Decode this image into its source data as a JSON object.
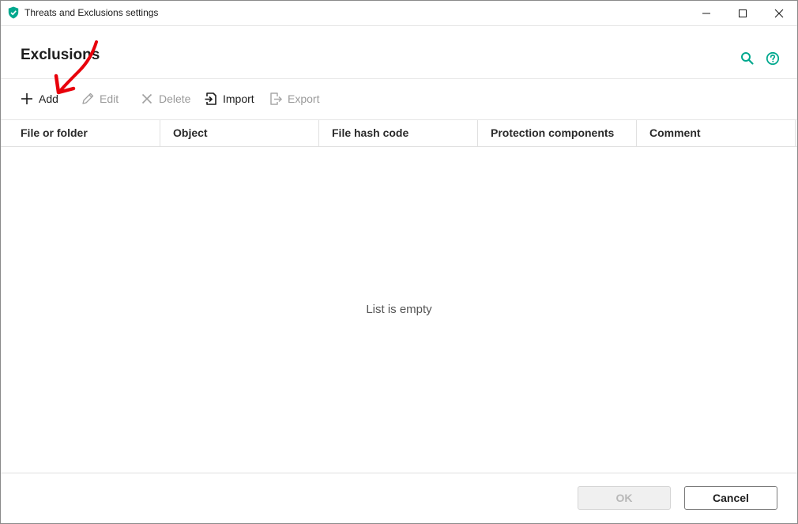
{
  "window": {
    "title": "Threats and Exclusions settings",
    "controls": {
      "minimize": "minimize",
      "maximize": "maximize",
      "close": "close"
    }
  },
  "header": {
    "title": "Exclusions",
    "icons": [
      "search-icon",
      "help-icon"
    ]
  },
  "toolbar": {
    "add_label": "Add",
    "edit_label": "Edit",
    "delete_label": "Delete",
    "import_label": "Import",
    "export_label": "Export"
  },
  "table": {
    "columns": [
      "File or folder",
      "Object",
      "File hash code",
      "Protection components",
      "Comment"
    ],
    "empty_text": "List is empty"
  },
  "footer": {
    "ok_label": "OK",
    "cancel_label": "Cancel"
  },
  "colors": {
    "accent": "#00a88e",
    "disabled_text": "#9a9a9a",
    "annotation": "#e8000b"
  }
}
